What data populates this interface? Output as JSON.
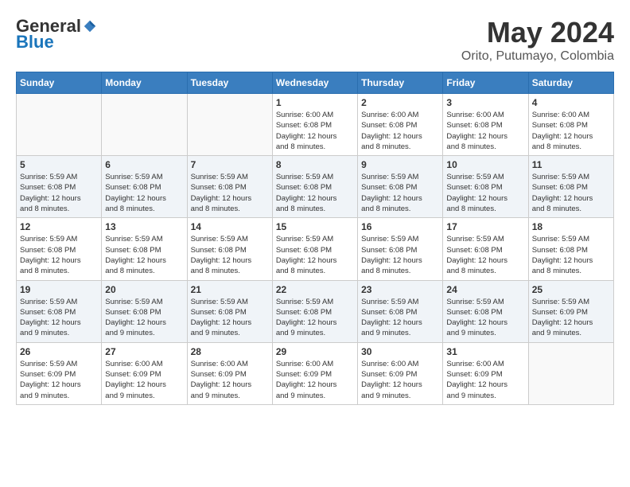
{
  "header": {
    "logo": {
      "general": "General",
      "blue": "Blue"
    },
    "title": "May 2024",
    "location": "Orito, Putumayo, Colombia"
  },
  "weekdays": [
    "Sunday",
    "Monday",
    "Tuesday",
    "Wednesday",
    "Thursday",
    "Friday",
    "Saturday"
  ],
  "weeks": [
    {
      "days": [
        {
          "num": "",
          "info": ""
        },
        {
          "num": "",
          "info": ""
        },
        {
          "num": "",
          "info": ""
        },
        {
          "num": "1",
          "info": "Sunrise: 6:00 AM\nSunset: 6:08 PM\nDaylight: 12 hours\nand 8 minutes."
        },
        {
          "num": "2",
          "info": "Sunrise: 6:00 AM\nSunset: 6:08 PM\nDaylight: 12 hours\nand 8 minutes."
        },
        {
          "num": "3",
          "info": "Sunrise: 6:00 AM\nSunset: 6:08 PM\nDaylight: 12 hours\nand 8 minutes."
        },
        {
          "num": "4",
          "info": "Sunrise: 6:00 AM\nSunset: 6:08 PM\nDaylight: 12 hours\nand 8 minutes."
        }
      ]
    },
    {
      "days": [
        {
          "num": "5",
          "info": "Sunrise: 5:59 AM\nSunset: 6:08 PM\nDaylight: 12 hours\nand 8 minutes."
        },
        {
          "num": "6",
          "info": "Sunrise: 5:59 AM\nSunset: 6:08 PM\nDaylight: 12 hours\nand 8 minutes."
        },
        {
          "num": "7",
          "info": "Sunrise: 5:59 AM\nSunset: 6:08 PM\nDaylight: 12 hours\nand 8 minutes."
        },
        {
          "num": "8",
          "info": "Sunrise: 5:59 AM\nSunset: 6:08 PM\nDaylight: 12 hours\nand 8 minutes."
        },
        {
          "num": "9",
          "info": "Sunrise: 5:59 AM\nSunset: 6:08 PM\nDaylight: 12 hours\nand 8 minutes."
        },
        {
          "num": "10",
          "info": "Sunrise: 5:59 AM\nSunset: 6:08 PM\nDaylight: 12 hours\nand 8 minutes."
        },
        {
          "num": "11",
          "info": "Sunrise: 5:59 AM\nSunset: 6:08 PM\nDaylight: 12 hours\nand 8 minutes."
        }
      ]
    },
    {
      "days": [
        {
          "num": "12",
          "info": "Sunrise: 5:59 AM\nSunset: 6:08 PM\nDaylight: 12 hours\nand 8 minutes."
        },
        {
          "num": "13",
          "info": "Sunrise: 5:59 AM\nSunset: 6:08 PM\nDaylight: 12 hours\nand 8 minutes."
        },
        {
          "num": "14",
          "info": "Sunrise: 5:59 AM\nSunset: 6:08 PM\nDaylight: 12 hours\nand 8 minutes."
        },
        {
          "num": "15",
          "info": "Sunrise: 5:59 AM\nSunset: 6:08 PM\nDaylight: 12 hours\nand 8 minutes."
        },
        {
          "num": "16",
          "info": "Sunrise: 5:59 AM\nSunset: 6:08 PM\nDaylight: 12 hours\nand 8 minutes."
        },
        {
          "num": "17",
          "info": "Sunrise: 5:59 AM\nSunset: 6:08 PM\nDaylight: 12 hours\nand 8 minutes."
        },
        {
          "num": "18",
          "info": "Sunrise: 5:59 AM\nSunset: 6:08 PM\nDaylight: 12 hours\nand 8 minutes."
        }
      ]
    },
    {
      "days": [
        {
          "num": "19",
          "info": "Sunrise: 5:59 AM\nSunset: 6:08 PM\nDaylight: 12 hours\nand 9 minutes."
        },
        {
          "num": "20",
          "info": "Sunrise: 5:59 AM\nSunset: 6:08 PM\nDaylight: 12 hours\nand 9 minutes."
        },
        {
          "num": "21",
          "info": "Sunrise: 5:59 AM\nSunset: 6:08 PM\nDaylight: 12 hours\nand 9 minutes."
        },
        {
          "num": "22",
          "info": "Sunrise: 5:59 AM\nSunset: 6:08 PM\nDaylight: 12 hours\nand 9 minutes."
        },
        {
          "num": "23",
          "info": "Sunrise: 5:59 AM\nSunset: 6:08 PM\nDaylight: 12 hours\nand 9 minutes."
        },
        {
          "num": "24",
          "info": "Sunrise: 5:59 AM\nSunset: 6:08 PM\nDaylight: 12 hours\nand 9 minutes."
        },
        {
          "num": "25",
          "info": "Sunrise: 5:59 AM\nSunset: 6:09 PM\nDaylight: 12 hours\nand 9 minutes."
        }
      ]
    },
    {
      "days": [
        {
          "num": "26",
          "info": "Sunrise: 5:59 AM\nSunset: 6:09 PM\nDaylight: 12 hours\nand 9 minutes."
        },
        {
          "num": "27",
          "info": "Sunrise: 6:00 AM\nSunset: 6:09 PM\nDaylight: 12 hours\nand 9 minutes."
        },
        {
          "num": "28",
          "info": "Sunrise: 6:00 AM\nSunset: 6:09 PM\nDaylight: 12 hours\nand 9 minutes."
        },
        {
          "num": "29",
          "info": "Sunrise: 6:00 AM\nSunset: 6:09 PM\nDaylight: 12 hours\nand 9 minutes."
        },
        {
          "num": "30",
          "info": "Sunrise: 6:00 AM\nSunset: 6:09 PM\nDaylight: 12 hours\nand 9 minutes."
        },
        {
          "num": "31",
          "info": "Sunrise: 6:00 AM\nSunset: 6:09 PM\nDaylight: 12 hours\nand 9 minutes."
        },
        {
          "num": "",
          "info": ""
        }
      ]
    }
  ]
}
